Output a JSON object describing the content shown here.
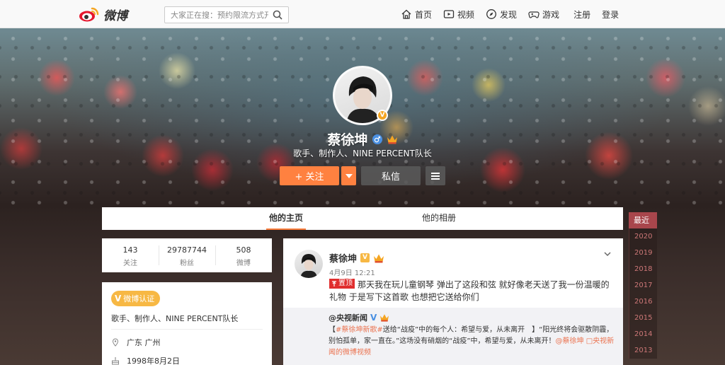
{
  "topbar": {
    "logo_text": "微博",
    "search_placeholder": "大家正在搜：预约限流方式开...",
    "nav": [
      {
        "label": "首页",
        "icon": "home-icon"
      },
      {
        "label": "视频",
        "icon": "video-icon"
      },
      {
        "label": "发现",
        "icon": "discover-icon"
      },
      {
        "label": "游戏",
        "icon": "game-icon"
      }
    ],
    "register": "注册",
    "login": "登录"
  },
  "profile": {
    "name": "蔡徐坤",
    "description": "歌手、制作人、NINE PERCENT队长",
    "badge": "V",
    "follow_label": "+ 关注",
    "message_label": "私信"
  },
  "tabs": [
    {
      "label": "他的主页",
      "active": true
    },
    {
      "label": "他的相册",
      "active": false
    }
  ],
  "years": [
    "最近",
    "2020",
    "2019",
    "2018",
    "2017",
    "2016",
    "2015",
    "2014",
    "2013"
  ],
  "stats": [
    {
      "value": "143",
      "label": "关注"
    },
    {
      "value": "29787744",
      "label": "粉丝"
    },
    {
      "value": "508",
      "label": "微博"
    }
  ],
  "info": {
    "cert_label": "微博认证",
    "cert_v": "V",
    "description": "歌手、制作人、NINE PERCENT队长",
    "location": "广东 广州",
    "birthday": "1998年8月2日"
  },
  "post": {
    "author": "蔡徐坤",
    "v_badge": "V",
    "time": "4月9日 12:21",
    "pin_label": "置顶",
    "text": "那天我在玩儿童钢琴 弹出了这段和弦 就好像老天送了我一份温暖的礼物 于是写下这首歌 也想把它送给你们",
    "repost": {
      "author": "@央视新闻",
      "v": "V",
      "text_prefix": "【",
      "topic": "#蔡徐坤新歌#",
      "text_mid": "送给“战疫”中的每个人：希望与爱，从未离开　】“阳光终将会驱散阴霾，别怕孤单，家一直在。”这场没有硝烟的“战疫”中，希望与爱，从未离开！",
      "mention": "@蔡徐坤",
      "link": "□央视新闻的微博视频"
    }
  },
  "colors": {
    "accent": "#ff8140",
    "year_active": "#a8464c",
    "cert": "#f7b844"
  }
}
